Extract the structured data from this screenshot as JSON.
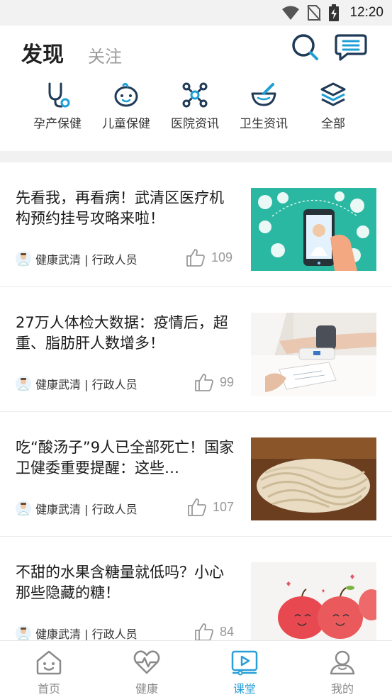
{
  "status_bar": {
    "time": "12:20"
  },
  "header": {
    "tab_active": "发现",
    "tab_inactive": "关注"
  },
  "categories": [
    {
      "label": "孕产保健",
      "icon": "stethoscope-icon"
    },
    {
      "label": "儿童保健",
      "icon": "baby-face-icon"
    },
    {
      "label": "医院资讯",
      "icon": "molecule-icon"
    },
    {
      "label": "卫生资讯",
      "icon": "mortar-icon"
    },
    {
      "label": "全部",
      "icon": "layers-icon"
    }
  ],
  "articles": [
    {
      "title": "先看我，再看病！武清区医疗机构预约挂号攻略来啦！",
      "author": "健康武清 | 行政人员",
      "likes": "109",
      "image": "medical-app-illustration"
    },
    {
      "title": "27万人体检大数据：疫情后，超重、脂肪肝人数增多！",
      "author": "健康武清 | 行政人员",
      "likes": "99",
      "image": "blood-pressure-check-photo"
    },
    {
      "title": "吃“酸汤子”9人已全部死亡！国家卫健委重要提醒：这些…",
      "author": "健康武清 | 行政人员",
      "likes": "107",
      "image": "noodles-photo"
    },
    {
      "title": "不甜的水果含糖量就低吗？小心那些隐藏的糖！",
      "author": "健康武清 | 行政人员",
      "likes": "84",
      "image": "apples-photo"
    }
  ],
  "bottom_nav": [
    {
      "label": "首页",
      "icon": "home-face-icon",
      "active": false
    },
    {
      "label": "健康",
      "icon": "heart-pulse-icon",
      "active": false
    },
    {
      "label": "课堂",
      "icon": "video-play-icon",
      "active": true
    },
    {
      "label": "我的",
      "icon": "user-icon",
      "active": false
    }
  ],
  "colors": {
    "accent": "#2a9fd8",
    "icon_dark": "#1f3b57",
    "icon_blue": "#1e9fd6"
  }
}
